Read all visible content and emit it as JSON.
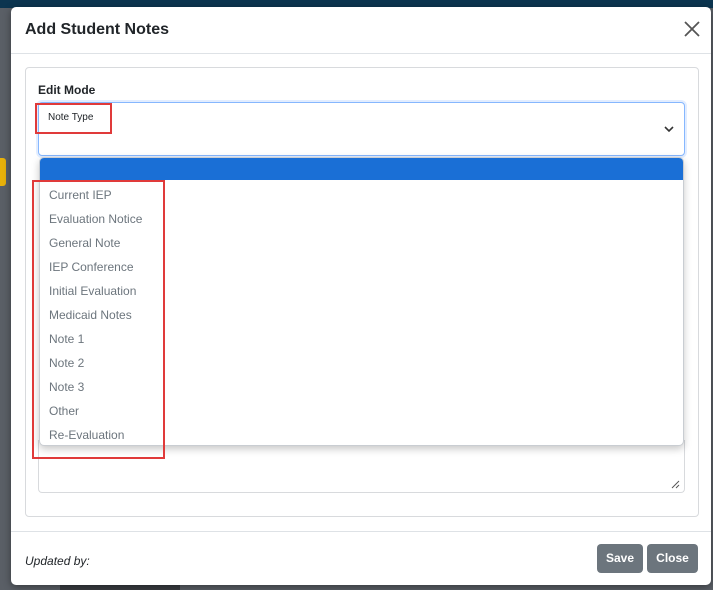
{
  "modal": {
    "title": "Add Student Notes",
    "section_label": "Edit Mode",
    "select": {
      "label": "Note Type",
      "selected_value": ""
    },
    "dropdown": {
      "options": [
        "Current IEP",
        "Evaluation Notice",
        "General Note",
        "IEP Conference",
        "Initial Evaluation",
        "Medicaid Notes",
        "Note 1",
        "Note 2",
        "Note 3",
        "Other",
        "Re-Evaluation"
      ]
    },
    "footer": {
      "updated_by": "Updated by:",
      "save_label": "Save",
      "close_label": "Close"
    }
  },
  "colors": {
    "highlight": "#1a6fd6",
    "button": "#6c757d",
    "callout": "#e03a3a",
    "focus_border": "#86b7fe"
  },
  "icons": {
    "close": "close-icon",
    "chevron": "chevron-down-icon",
    "resize": "resize-handle-icon"
  }
}
